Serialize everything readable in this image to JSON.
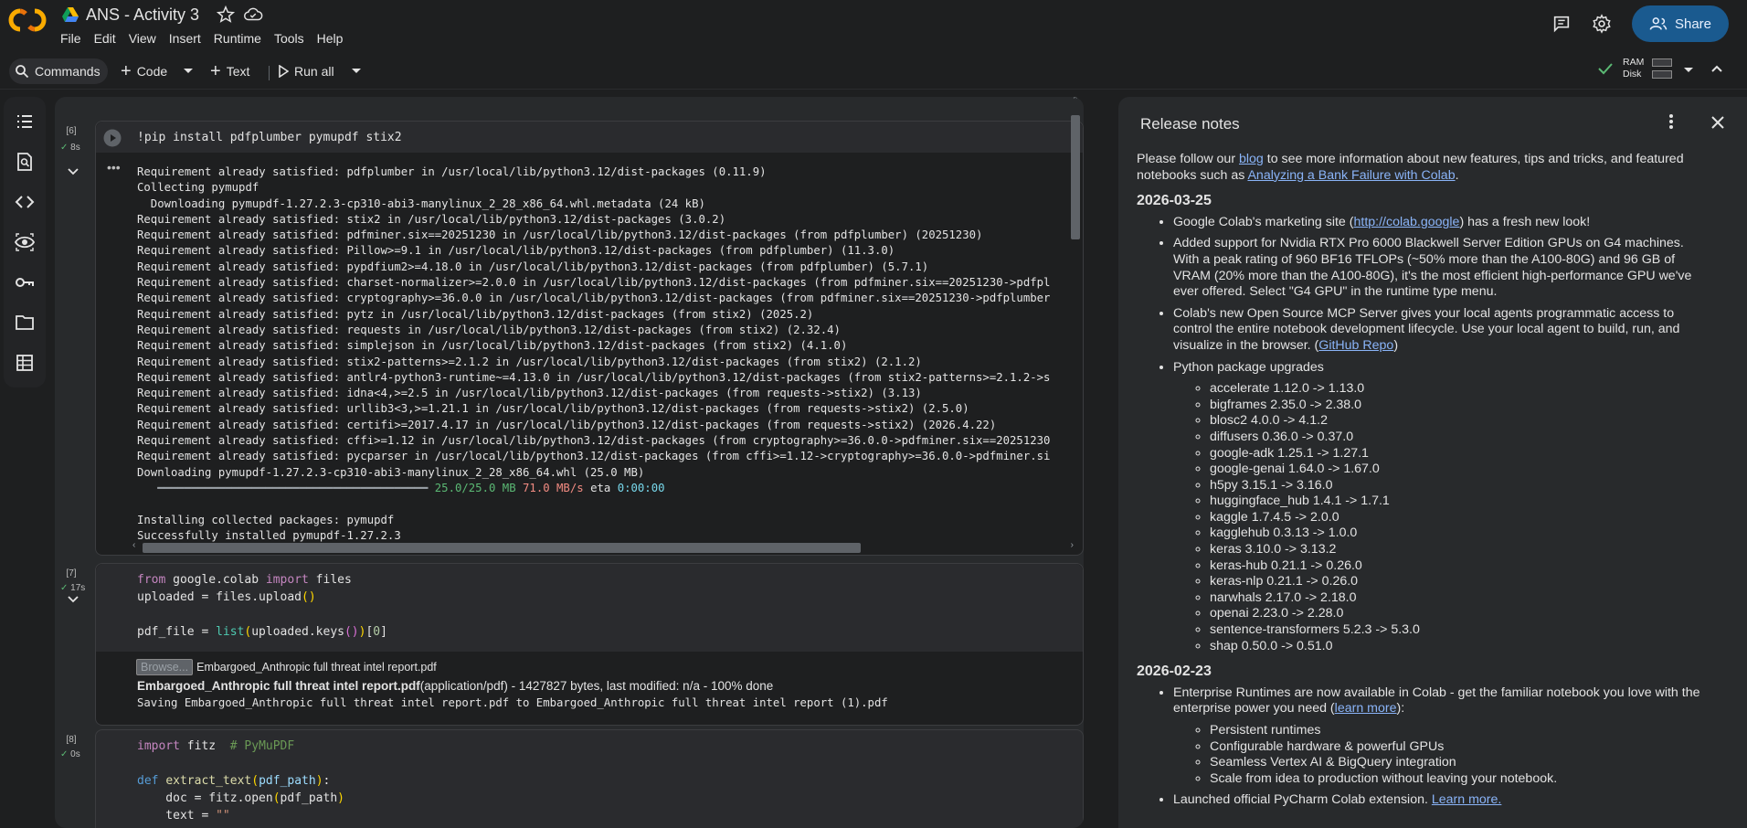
{
  "app": {
    "title": "ANS - Activity 3",
    "menu": [
      "File",
      "Edit",
      "View",
      "Insert",
      "Runtime",
      "Tools",
      "Help"
    ],
    "share_label": "Share",
    "accent": "#1a5a8f"
  },
  "toolbar": {
    "commands_label": "Commands",
    "code_label": "Code",
    "text_label": "Text",
    "run_all_label": "Run all",
    "ram_label": "RAM",
    "disk_label": "Disk"
  },
  "cells": [
    {
      "count": "[6]",
      "time": "8s",
      "code": "!pip install pdfplumber pymupdf stix2",
      "output": [
        "Requirement already satisfied: pdfplumber in /usr/local/lib/python3.12/dist-packages (0.11.9)",
        "Collecting pymupdf",
        "  Downloading pymupdf-1.27.2.3-cp310-abi3-manylinux_2_28_x86_64.whl.metadata (24 kB)",
        "Requirement already satisfied: stix2 in /usr/local/lib/python3.12/dist-packages (3.0.2)",
        "Requirement already satisfied: pdfminer.six==20251230 in /usr/local/lib/python3.12/dist-packages (from pdfplumber) (20251230)",
        "Requirement already satisfied: Pillow>=9.1 in /usr/local/lib/python3.12/dist-packages (from pdfplumber) (11.3.0)",
        "Requirement already satisfied: pypdfium2>=4.18.0 in /usr/local/lib/python3.12/dist-packages (from pdfplumber) (5.7.1)",
        "Requirement already satisfied: charset-normalizer>=2.0.0 in /usr/local/lib/python3.12/dist-packages (from pdfminer.six==20251230->pdfpl",
        "Requirement already satisfied: cryptography>=36.0.0 in /usr/local/lib/python3.12/dist-packages (from pdfminer.six==20251230->pdfplumber",
        "Requirement already satisfied: pytz in /usr/local/lib/python3.12/dist-packages (from stix2) (2025.2)",
        "Requirement already satisfied: requests in /usr/local/lib/python3.12/dist-packages (from stix2) (2.32.4)",
        "Requirement already satisfied: simplejson in /usr/local/lib/python3.12/dist-packages (from stix2) (4.1.0)",
        "Requirement already satisfied: stix2-patterns>=2.1.2 in /usr/local/lib/python3.12/dist-packages (from stix2) (2.1.2)",
        "Requirement already satisfied: antlr4-python3-runtime~=4.13.0 in /usr/local/lib/python3.12/dist-packages (from stix2-patterns>=2.1.2->s",
        "Requirement already satisfied: idna<4,>=2.5 in /usr/local/lib/python3.12/dist-packages (from requests->stix2) (3.13)",
        "Requirement already satisfied: urllib3<3,>=1.21.1 in /usr/local/lib/python3.12/dist-packages (from requests->stix2) (2.5.0)",
        "Requirement already satisfied: certifi>=2017.4.17 in /usr/local/lib/python3.12/dist-packages (from requests->stix2) (2026.4.22)",
        "Requirement already satisfied: cffi>=1.12 in /usr/local/lib/python3.12/dist-packages (from cryptography>=36.0.0->pdfminer.six==20251230",
        "Requirement already satisfied: pycparser in /usr/local/lib/python3.12/dist-packages (from cffi>=1.12->cryptography>=36.0.0->pdfminer.si",
        "Downloading pymupdf-1.27.2.3-cp310-abi3-manylinux_2_28_x86_64.whl (25.0 MB)"
      ],
      "progress": {
        "bar": "━━━━━━━━━━━━━━━━━━━━━━━━━━━━━━━━━━━━━━━━",
        "size": "25.0/25.0 MB",
        "speed": "71.0 MB/s",
        "eta_label": "eta",
        "eta": "0:00:00"
      },
      "output_tail": [
        "",
        "Installing collected packages: pymupdf",
        "Successfully installed pymupdf-1.27.2.3"
      ]
    },
    {
      "count": "[7]",
      "time": "17s",
      "upload": {
        "browse_label": "Browse...",
        "file_name": "Embargoed_Anthropic full threat intel report.pdf",
        "bold_name": "Embargoed_Anthropic full threat intel report.pdf",
        "file_meta": "(application/pdf) - 1427827 bytes, last modified: n/a - 100% done",
        "saving": "Saving Embargoed_Anthropic full threat intel report.pdf to Embargoed_Anthropic full threat intel report (1).pdf"
      }
    },
    {
      "count": "[8]",
      "time": "0s"
    }
  ],
  "release_notes": {
    "title": "Release notes",
    "intro_1": "Please follow our ",
    "intro_link_1": "blog",
    "intro_2": " to see more information about new features, tips and tricks, and featured notebooks such as ",
    "intro_link_2": "Analyzing a Bank Failure with Colab",
    "intro_3": ".",
    "date_1": "2026-03-25",
    "item_1a": "Google Colab's marketing site (",
    "item_1a_link": "http://colab.google",
    "item_1a_end": ") has a fresh new look!",
    "item_1b": "Added support for Nvidia RTX Pro 6000 Blackwell Server Edition GPUs on G4 machines. With a peak rating of 960 BF16 TFLOPs (~50% more than the A100-80G) and 96 GB of VRAM (20% more than the A100-80G), it's the most efficient high-performance GPU we've ever offered. Select \"G4 GPU\" in the runtime type menu.",
    "item_1c": "Colab's new Open Source MCP Server gives your local agents programmatic access to control the entire notebook development lifecycle. Use your local agent to build, run, and visualize in the browser. (",
    "item_1c_link": "GitHub Repo",
    "item_1c_end": ")",
    "item_1d": "Python package upgrades",
    "packages": [
      "accelerate 1.12.0 -> 1.13.0",
      "bigframes 2.35.0 -> 2.38.0",
      "blosc2 4.0.0 -> 4.1.2",
      "diffusers 0.36.0 -> 0.37.0",
      "google-adk 1.25.1 -> 1.27.1",
      "google-genai 1.64.0 -> 1.67.0",
      "h5py 3.15.1 -> 3.16.0",
      "huggingface_hub 1.4.1 -> 1.7.1",
      "kaggle 1.7.4.5 -> 2.0.0",
      "kagglehub 0.3.13 -> 1.0.0",
      "keras 3.10.0 -> 3.13.2",
      "keras-hub 0.21.1 -> 0.26.0",
      "keras-nlp 0.21.1 -> 0.26.0",
      "narwhals 2.17.0 -> 2.18.0",
      "openai 2.23.0 -> 2.28.0",
      "sentence-transformers 5.2.3 -> 5.3.0",
      "shap 0.50.0 -> 0.51.0"
    ],
    "date_2": "2026-02-23",
    "item_2a": "Enterprise Runtimes are now available in Colab - get the familiar notebook you love with the enterprise power you need (",
    "item_2a_link": "learn more",
    "item_2a_end": "):",
    "enterprise": [
      "Persistent runtimes",
      "Configurable hardware & powerful GPUs",
      "Seamless Vertex AI & BigQuery integration",
      "Scale from idea to production without leaving your notebook."
    ],
    "item_2b": "Launched official PyCharm Colab extension. ",
    "item_2b_link": "Learn more."
  }
}
